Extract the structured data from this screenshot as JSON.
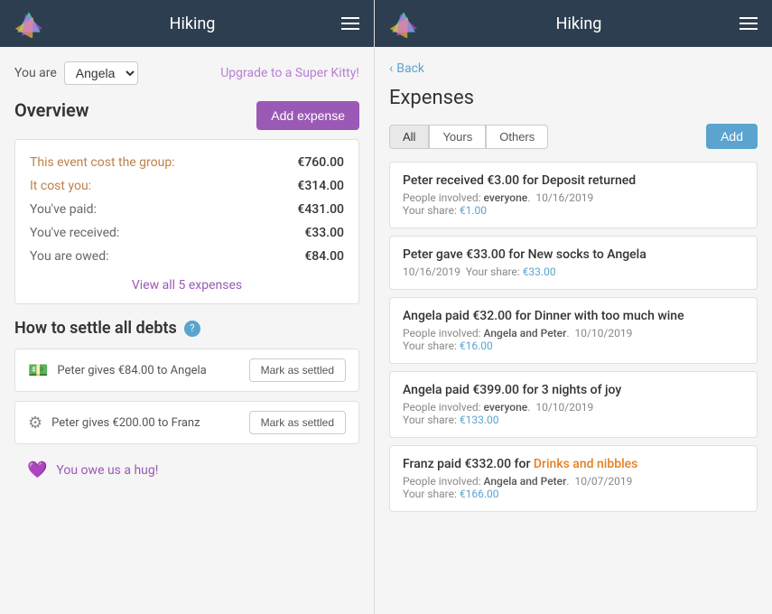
{
  "app": {
    "title": "Hiking",
    "menu_icon": "≡"
  },
  "left_panel": {
    "you_are_label": "You are",
    "user": "Angela",
    "upgrade_link": "Upgrade to a Super Kitty!",
    "overview": {
      "title": "Overview",
      "add_expense_btn": "Add expense",
      "rows": [
        {
          "label": "This event cost the group:",
          "amount": "€760.00",
          "type": "orange"
        },
        {
          "label": "It cost you:",
          "amount": "€314.00",
          "type": "orange"
        },
        {
          "label": "You've paid:",
          "amount": "€431.00",
          "type": "dark"
        },
        {
          "label": "You've received:",
          "amount": "€33.00",
          "type": "dark"
        },
        {
          "label": "You are owed:",
          "amount": "€84.00",
          "type": "dark"
        }
      ],
      "view_all": "View all 5 expenses"
    },
    "settle": {
      "title": "How to settle all debts",
      "debts": [
        {
          "text": "Peter gives €84.00 to Angela",
          "btn": "Mark as settled",
          "icon": "💵"
        },
        {
          "text": "Peter gives €200.00 to Franz",
          "btn": "Mark as settled",
          "icon": "⚙️"
        }
      ],
      "hug": {
        "text": "You owe us a hug!",
        "icon": "💜"
      }
    }
  },
  "right_panel": {
    "back": "Back",
    "expenses_title": "Expenses",
    "filter_tabs": [
      {
        "label": "All",
        "active": true
      },
      {
        "label": "Yours",
        "active": false
      },
      {
        "label": "Others",
        "active": false
      }
    ],
    "add_btn": "Add",
    "expenses": [
      {
        "title": "Peter received €3.00 for Deposit returned",
        "people": "everyone",
        "date": "10/16/2019",
        "share_label": "Your share:",
        "share": "€1.00",
        "has_people_label": true
      },
      {
        "title": "Peter gave €33.00 for New socks to Angela",
        "date": "10/16/2019",
        "share_label": "Your share:",
        "share": "€33.00",
        "has_people_label": false
      },
      {
        "title": "Angela paid €32.00 for Dinner with too much wine",
        "people": "Angela and Peter",
        "date": "10/10/2019",
        "share_label": "Your share:",
        "share": "€16.00",
        "has_people_label": true
      },
      {
        "title": "Angela paid €399.00 for 3 nights of joy",
        "people": "everyone",
        "date": "10/10/2019",
        "share_label": "Your share:",
        "share": "€133.00",
        "has_people_label": true
      },
      {
        "title_start": "Franz paid €332.00 for ",
        "title_highlight": "Drinks and nibbles",
        "people": "Angela and Peter",
        "date": "10/07/2019",
        "share_label": "Your share:",
        "share": "€166.00",
        "has_people_label": true,
        "has_highlight": true
      }
    ]
  }
}
